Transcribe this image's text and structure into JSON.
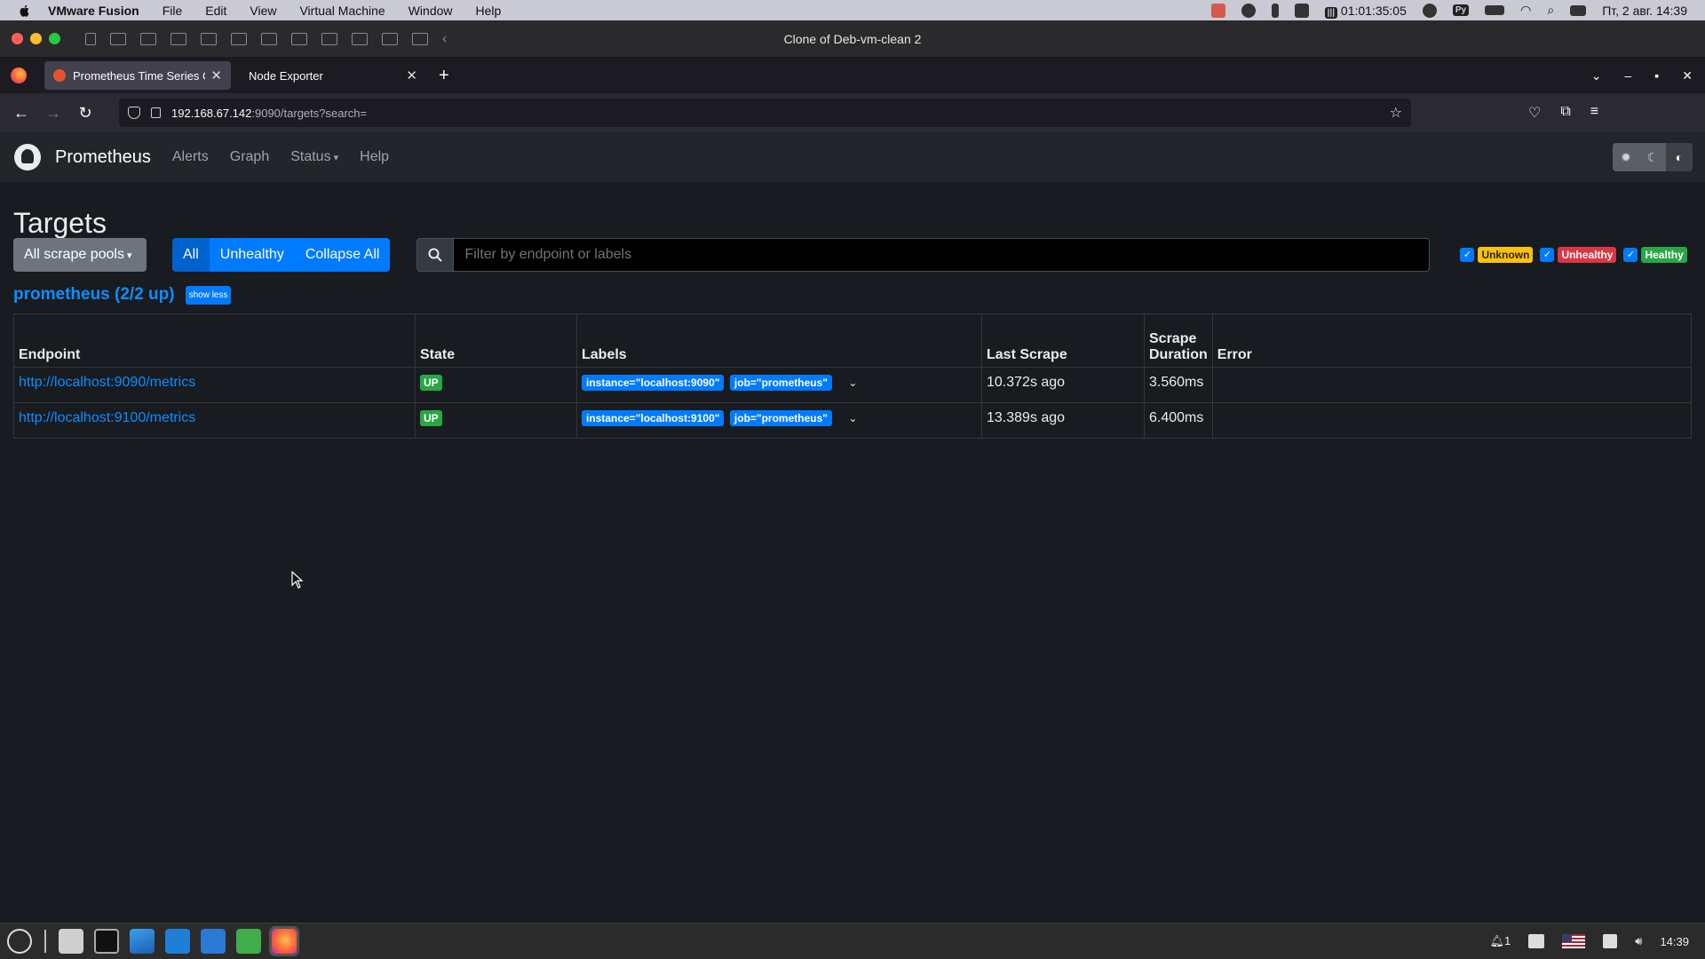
{
  "menubar": {
    "app_name": "VMware Fusion",
    "items": [
      "File",
      "Edit",
      "View",
      "Virtual Machine",
      "Window",
      "Help"
    ],
    "timer": "01:01:35:05",
    "lang": "Ру",
    "datetime": "Пт, 2 авг. 14:39"
  },
  "vm": {
    "title": "Clone of Deb-vm-clean 2"
  },
  "browser": {
    "tabs": [
      {
        "label": "Prometheus Time Series Colle"
      },
      {
        "label": "Node Exporter"
      }
    ],
    "url_host": "192.168.67.142",
    "url_rest": ":9090/targets?search="
  },
  "prom": {
    "brand": "Prometheus",
    "nav": [
      "Alerts",
      "Graph",
      "Status",
      "Help"
    ],
    "heading": "Targets",
    "pool_button": "All scrape pools",
    "filter_buttons": [
      "All",
      "Unhealthy",
      "Collapse All"
    ],
    "search_placeholder": "Filter by endpoint or labels",
    "badges": [
      "Unknown",
      "Unhealthy",
      "Healthy"
    ],
    "pool_title": "prometheus (2/2 up)",
    "show_less": "show less",
    "columns": [
      "Endpoint",
      "State",
      "Labels",
      "Last Scrape",
      "Scrape Duration",
      "Error"
    ],
    "rows": [
      {
        "endpoint": "http://localhost:9090/metrics",
        "state": "UP",
        "labels": [
          "instance=\"localhost:9090\"",
          "job=\"prometheus\""
        ],
        "last_scrape": "10.372s ago",
        "duration": "3.560ms",
        "error": ""
      },
      {
        "endpoint": "http://localhost:9100/metrics",
        "state": "UP",
        "labels": [
          "instance=\"localhost:9100\"",
          "job=\"prometheus\""
        ],
        "last_scrape": "13.389s ago",
        "duration": "6.400ms",
        "error": ""
      }
    ]
  },
  "taskbar": {
    "clock": "14:39",
    "notif_count": "1"
  }
}
